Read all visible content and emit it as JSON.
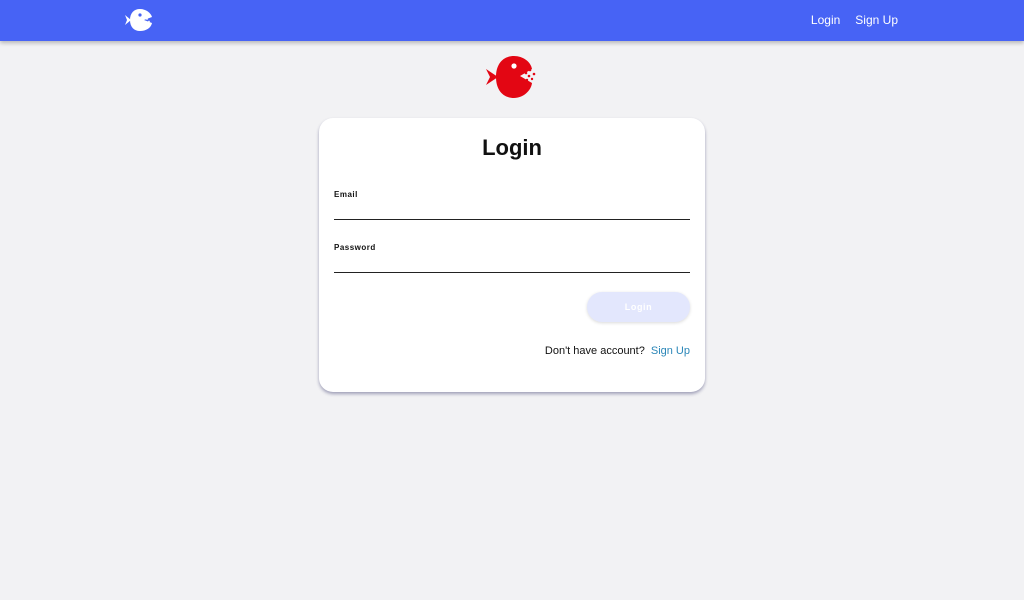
{
  "navbar": {
    "logo_icon": "fish-logo-icon",
    "links": [
      {
        "label": "Login"
      },
      {
        "label": "Sign Up"
      }
    ],
    "background": "#4763f5"
  },
  "hero": {
    "logo_icon": "fish-logo-icon",
    "logo_color": "#e30613"
  },
  "login_form": {
    "title": "Login",
    "email": {
      "label": "Email",
      "value": "",
      "placeholder": ""
    },
    "password": {
      "label": "Password",
      "value": "",
      "placeholder": ""
    },
    "submit_label": "Login",
    "signup_prompt": "Don't have account?",
    "signup_link": "Sign Up"
  }
}
